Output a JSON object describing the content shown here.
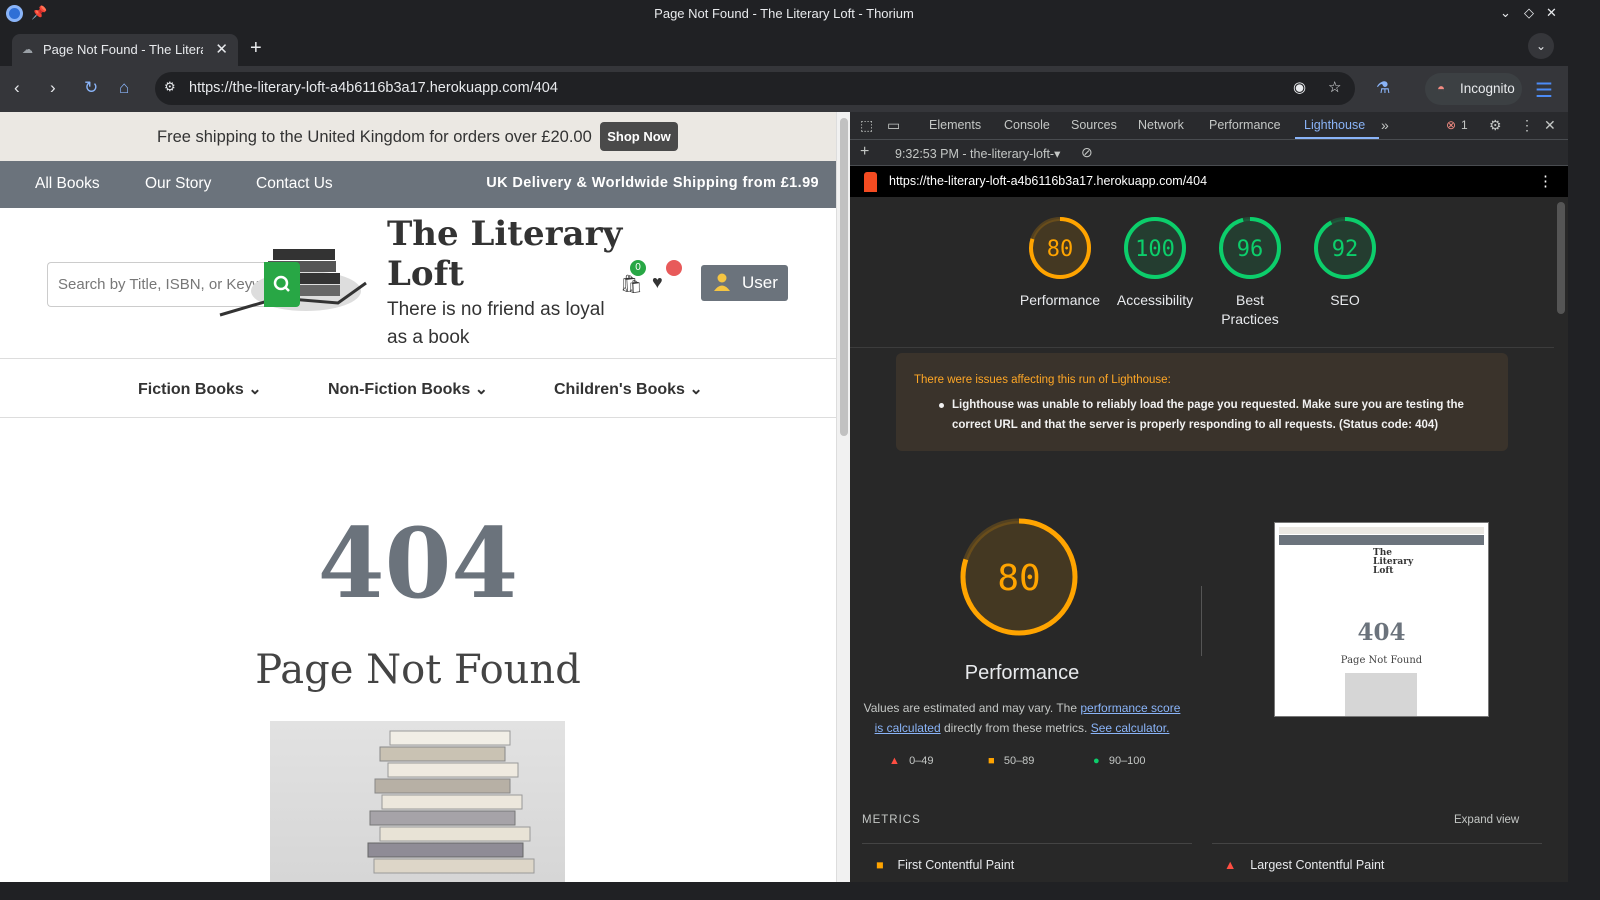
{
  "window": {
    "title": "Page Not Found - The Literary Loft - Thorium"
  },
  "tabs": [
    {
      "label": "Page Not Found - The Literary Loft"
    }
  ],
  "address_bar": {
    "url": "https://the-literary-loft-a4b6116b3a17.herokuapp.com/404"
  },
  "profile": {
    "label": "Incognito"
  },
  "site": {
    "promo_text": "Free shipping to the United Kingdom for orders over £20.00",
    "shop_now": "Shop Now",
    "nav": [
      "All Books",
      "Our Story",
      "Contact Us"
    ],
    "shipping_note": "UK Delivery & Worldwide Shipping from £1.99",
    "search_placeholder": "Search by Title, ISBN, or Keyword",
    "brand_line1": "The Literary",
    "brand_line2": "Loft",
    "tagline": "There is no friend as loyal as a book",
    "cart_count": "0",
    "user_label": "User",
    "categories": [
      "Fiction Books",
      "Non-Fiction Books",
      "Children's Books"
    ],
    "error_code": "404",
    "error_title": "Page Not Found"
  },
  "devtools": {
    "tabs": [
      "Elements",
      "Console",
      "Sources",
      "Network",
      "Performance",
      "Lighthouse"
    ],
    "active_tab": "Lighthouse",
    "error_count": "1",
    "report_label": "9:32:53 PM - the-literary-loft-",
    "report_url": "https://the-literary-loft-a4b6116b3a17.herokuapp.com/404",
    "scores": [
      {
        "label": "Performance",
        "value": 80,
        "color": "#ffa400"
      },
      {
        "label": "Accessibility",
        "value": 100,
        "color": "#0cce6b"
      },
      {
        "label": "Best Practices",
        "value": 96,
        "color": "#0cce6b"
      },
      {
        "label": "SEO",
        "value": 92,
        "color": "#0cce6b"
      }
    ],
    "warning_title": "There were issues affecting this run of Lighthouse:",
    "warning_text": "Lighthouse was unable to reliably load the page you requested. Make sure you are testing the correct URL and that the server is properly responding to all requests. (Status code: 404)",
    "perf_score": 80,
    "perf_title": "Performance",
    "desc_prefix": "Values are estimated and may vary. The ",
    "desc_link1": "performance score is calculated",
    "desc_mid": " directly from these metrics. ",
    "desc_link2": "See calculator.",
    "legend": [
      "0–49",
      "50–89",
      "90–100"
    ],
    "metrics_label": "METRICS",
    "expand_label": "Expand view",
    "metrics": [
      "First Contentful Paint",
      "Largest Contentful Paint"
    ],
    "thumb": {
      "error_code": "404",
      "error_title": "Page Not Found",
      "brand": "The Literary Loft"
    }
  }
}
